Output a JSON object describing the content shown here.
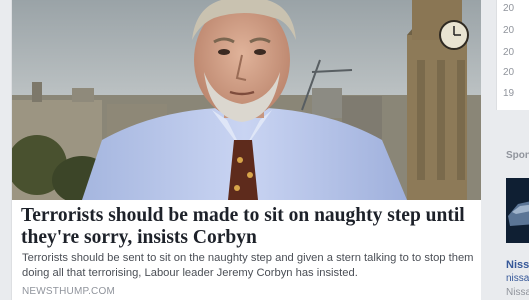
{
  "post": {
    "headline": "Terrorists should be made to sit on naughty step until they're sorry, insists Corbyn",
    "summary": "Terrorists should be sent to sit on the naughty step and given a stern talking to to stop them doing all that terrorising, Labour leader Jeremy Corbyn has insisted.",
    "domain": "NEWSTHUMP.COM"
  },
  "sidebar": {
    "years": [
      "20",
      "20",
      "20",
      "20",
      "19"
    ],
    "sponsored_label": "Spons",
    "ad_title": "Nissa",
    "ad_subtitle": "nissar",
    "ad_subtitle2": "Nissan"
  },
  "colors": {
    "page_bg": "#e9ebee",
    "headline": "#1d2129",
    "summary": "#4b4f56",
    "domain": "#90949c",
    "link": "#365899"
  }
}
